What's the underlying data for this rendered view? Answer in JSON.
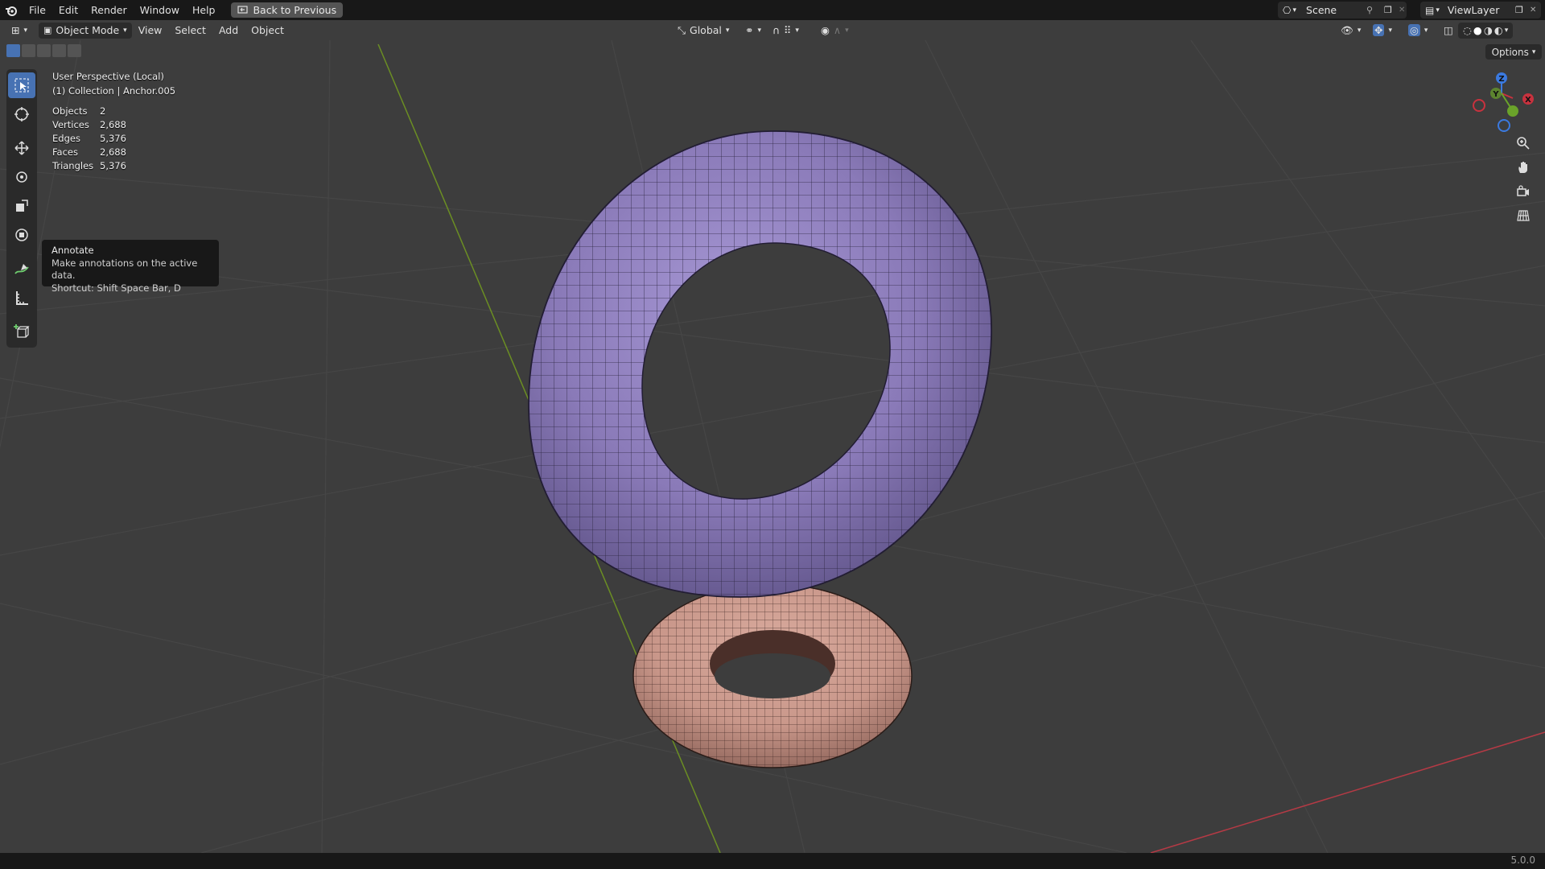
{
  "menu": {
    "items": [
      "File",
      "Edit",
      "Render",
      "Window",
      "Help"
    ],
    "back_button": "Back to Previous",
    "scene": "Scene",
    "view_layer": "ViewLayer"
  },
  "header": {
    "mode": "Object Mode",
    "menus": [
      "View",
      "Select",
      "Add",
      "Object"
    ],
    "orientation": "Global",
    "options": "Options"
  },
  "viewport": {
    "perspective": "User Perspective (Local)",
    "collection": "(1) Collection | Anchor.005"
  },
  "stats": [
    {
      "label": "Objects",
      "value": "2"
    },
    {
      "label": "Vertices",
      "value": "2,688"
    },
    {
      "label": "Edges",
      "value": "5,376"
    },
    {
      "label": "Faces",
      "value": "2,688"
    },
    {
      "label": "Triangles",
      "value": "5,376"
    }
  ],
  "tooltip": {
    "title": "Annotate",
    "description": "Make annotations on the active data.",
    "shortcut": "Shortcut: Shift Space Bar, D"
  },
  "gizmo": {
    "z": "Z",
    "y": "Y",
    "x": "X"
  },
  "colors": {
    "accent": "#4772b3",
    "large_torus": "#8a7ab8",
    "small_torus": "#c9978a",
    "y_axis_line": "#6b8e23",
    "x_axis_line": "#b53a45"
  },
  "status": {
    "version": "5.0.0"
  }
}
